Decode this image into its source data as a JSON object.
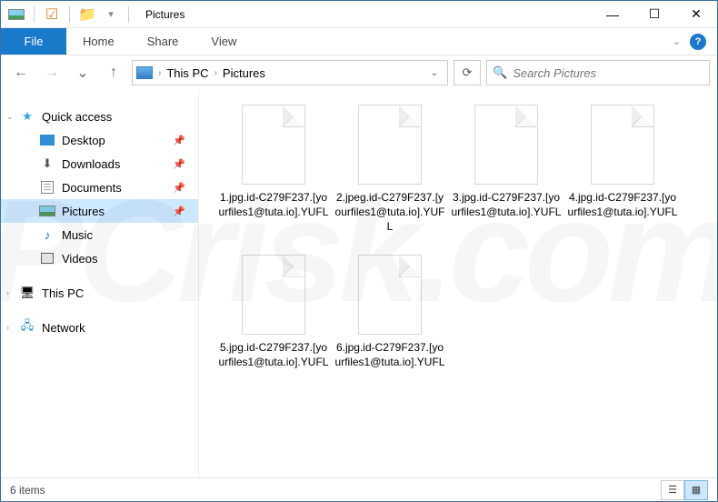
{
  "window": {
    "title": "Pictures"
  },
  "ribbon": {
    "file": "File",
    "tabs": [
      "Home",
      "Share",
      "View"
    ]
  },
  "breadcrumb": {
    "items": [
      "This PC",
      "Pictures"
    ]
  },
  "search": {
    "placeholder": "Search Pictures"
  },
  "nav": {
    "quick_access": "Quick access",
    "items": [
      {
        "label": "Desktop",
        "icon": "desktop"
      },
      {
        "label": "Downloads",
        "icon": "downloads"
      },
      {
        "label": "Documents",
        "icon": "documents"
      },
      {
        "label": "Pictures",
        "icon": "pictures",
        "selected": true
      },
      {
        "label": "Music",
        "icon": "music"
      },
      {
        "label": "Videos",
        "icon": "videos"
      }
    ],
    "this_pc": "This PC",
    "network": "Network"
  },
  "files": [
    {
      "name": "1.jpg.id-C279F237.[yourfiles1@tuta.io].YUFL"
    },
    {
      "name": "2.jpeg.id-C279F237.[yourfiles1@tuta.io].YUFL"
    },
    {
      "name": "3.jpg.id-C279F237.[yourfiles1@tuta.io].YUFL"
    },
    {
      "name": "4.jpg.id-C279F237.[yourfiles1@tuta.io].YUFL"
    },
    {
      "name": "5.jpg.id-C279F237.[yourfiles1@tuta.io].YUFL"
    },
    {
      "name": "6.jpg.id-C279F237.[yourfiles1@tuta.io].YUFL"
    }
  ],
  "status": {
    "count": "6 items"
  },
  "watermark": "PCrisk.com"
}
